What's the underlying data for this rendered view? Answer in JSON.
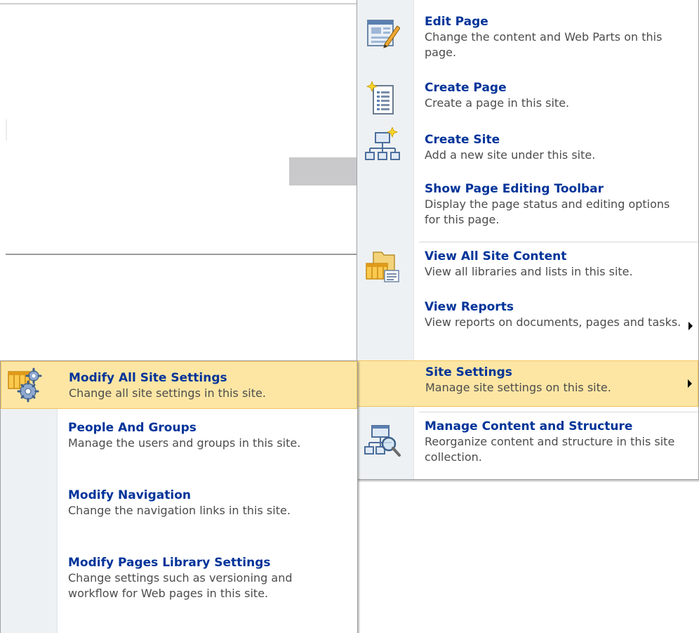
{
  "main_menu": {
    "items": [
      {
        "title": "Edit Page",
        "desc": "Change the content and Web Parts on this page.",
        "icon": "edit-page-icon"
      },
      {
        "title": "Create Page",
        "desc": "Create a page in this site.",
        "icon": "create-page-icon"
      },
      {
        "title": "Create Site",
        "desc": "Add a new site under this site.",
        "icon": "create-site-icon"
      },
      {
        "title": "Show Page Editing Toolbar",
        "desc": "Display the page status and editing options for this page.",
        "icon": ""
      },
      {
        "title": "View All Site Content",
        "desc": "View all libraries and lists in this site.",
        "icon": "site-content-icon"
      },
      {
        "title": "View Reports",
        "desc": "View reports on documents, pages and tasks.",
        "icon": "",
        "has_submenu": true
      },
      {
        "title": "Site Settings",
        "desc": "Manage site settings on this site.",
        "icon": "",
        "has_submenu": true,
        "highlighted": true
      },
      {
        "title": "Manage Content and Structure",
        "desc": "Reorganize content and structure in this site collection.",
        "icon": "manage-structure-icon"
      }
    ]
  },
  "sub_menu": {
    "items": [
      {
        "title": "Modify All Site Settings",
        "desc": "Change all site settings in this site.",
        "icon": "site-settings-gear-icon",
        "highlighted": true
      },
      {
        "title": "People And Groups",
        "desc": "Manage the users and groups in this site.",
        "icon": ""
      },
      {
        "title": "Modify Navigation",
        "desc": "Change the navigation links in this site.",
        "icon": ""
      },
      {
        "title": "Modify Pages Library Settings",
        "desc": "Change settings such as versioning and workflow for Web pages in this site.",
        "icon": ""
      }
    ]
  },
  "colors": {
    "title": "#003399",
    "description": "#4c4c4c",
    "highlight": "#fde6a4",
    "highlight_border": "#f2c45a",
    "gutter": "#eef1f3"
  }
}
